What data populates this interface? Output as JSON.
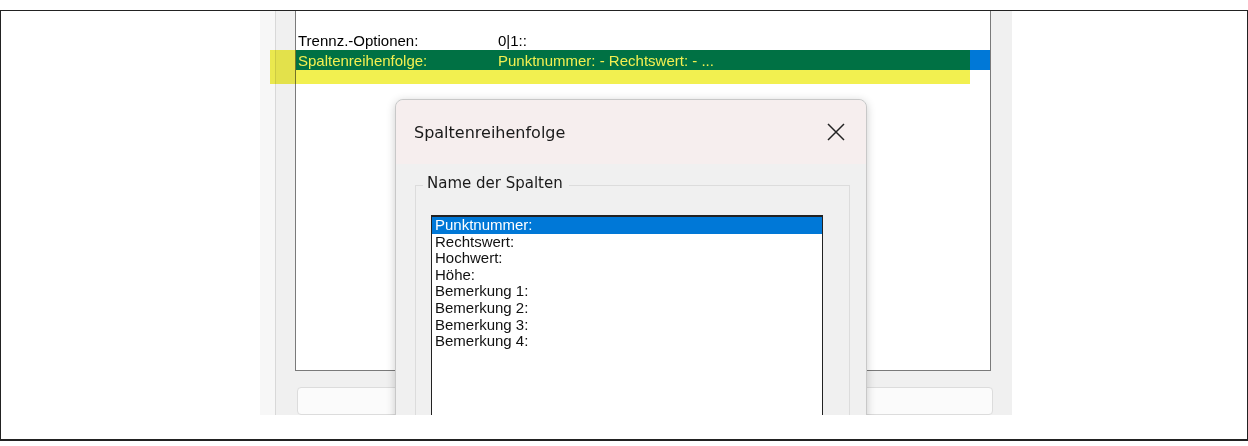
{
  "settings": {
    "rows": [
      {
        "label": "Trennz.-Optionen:",
        "value": "0|1::",
        "selected": false,
        "highlighted": false
      },
      {
        "label": "Spaltenreihenfolge:",
        "value": "Punktnummer: - Rechtswert: - ...",
        "selected": true,
        "highlighted": true
      }
    ]
  },
  "dialog": {
    "title": "Spaltenreihenfolge",
    "group": {
      "label": "Name der Spalten",
      "items": [
        {
          "label": "Punktnummer:",
          "selected": true
        },
        {
          "label": "Rechtswert:",
          "selected": false
        },
        {
          "label": "Hochwert:",
          "selected": false
        },
        {
          "label": "Höhe:",
          "selected": false
        },
        {
          "label": "Bemerkung 1:",
          "selected": false
        },
        {
          "label": "Bemerkung 2:",
          "selected": false
        },
        {
          "label": "Bemerkung 3:",
          "selected": false
        },
        {
          "label": "Bemerkung 4:",
          "selected": false
        }
      ]
    }
  }
}
